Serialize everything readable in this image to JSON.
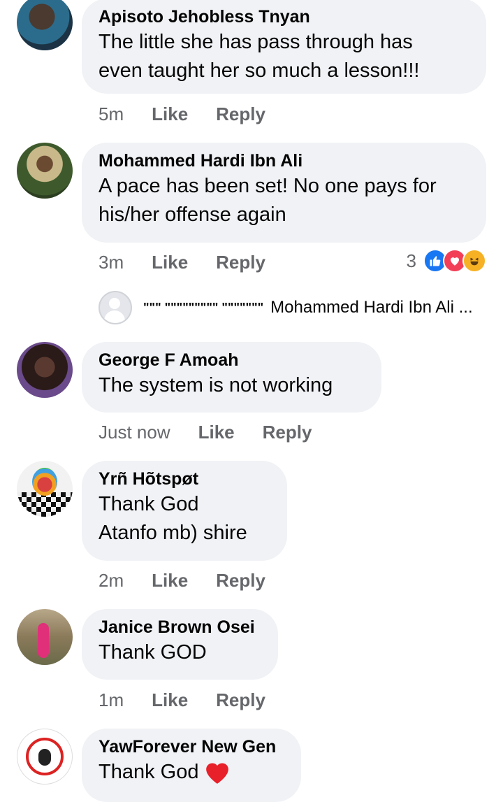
{
  "comments": [
    {
      "author": "Apisoto Jehobless Tnyan",
      "text": "The little she has pass through has\neven taught her so much a lesson!!!",
      "time": "5m",
      "like": "Like",
      "reply": "Reply"
    },
    {
      "author": "Mohammed Hardi Ibn Ali",
      "text": "A pace has been set! No one pays for\nhis/her offense again",
      "time": "3m",
      "like": "Like",
      "reply": "Reply",
      "reaction_count": "3"
    },
    {
      "author": "George F Amoah",
      "text": "The system is not working",
      "time": "Just now",
      "like": "Like",
      "reply": "Reply"
    },
    {
      "author": "Yrñ Hõtspøt",
      "text": "Thank God\nAtanfo mb) shire",
      "time": "2m",
      "like": "Like",
      "reply": "Reply"
    },
    {
      "author": "Janice Brown Osei",
      "text": "Thank GOD",
      "time": "1m",
      "like": "Like",
      "reply": "Reply"
    },
    {
      "author": "YawForever New Gen",
      "text": "Thank God"
    }
  ],
  "reply_preview": {
    "name": "\"\"\" \"\"\"\"\"\"\"\"\" \"\"\"\"\"\"\"",
    "snippet": "Mohammed Hardi Ibn Ali ..."
  },
  "colors": {
    "bubble": "#f0f2f5",
    "meta": "#65676b",
    "like_blue": "#1877f2",
    "love_red": "#f33e58",
    "haha_yellow": "#f7b125"
  },
  "icons": [
    "like-reaction-icon",
    "love-reaction-icon",
    "haha-reaction-icon",
    "heart-emoji-icon",
    "default-avatar-icon"
  ]
}
